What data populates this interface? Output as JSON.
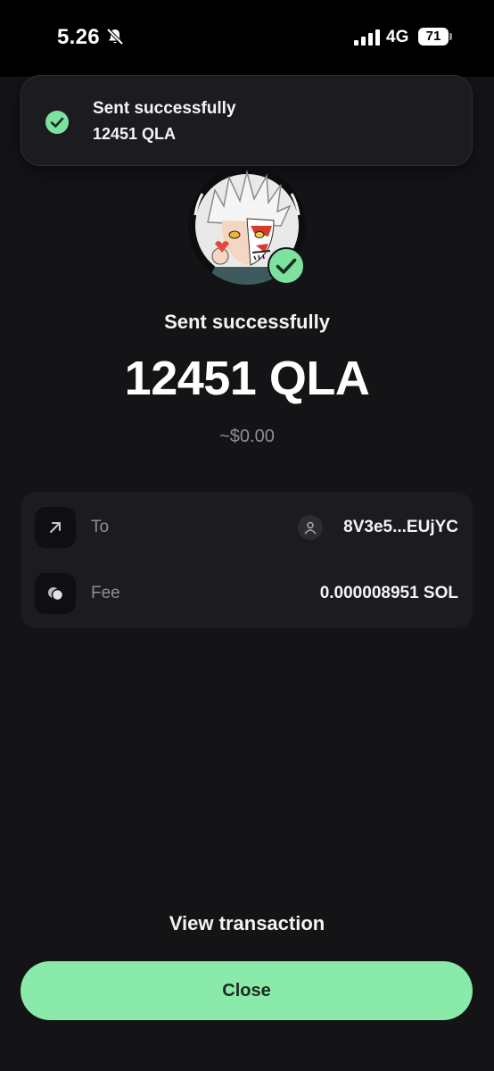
{
  "status_bar": {
    "time": "5.26",
    "network": "4G",
    "battery": "71"
  },
  "toast": {
    "title": "Sent successfully",
    "amount": "12451 QLA"
  },
  "result": {
    "headline": "Sent successfully",
    "amount": "12451 QLA",
    "fiat_value": "~$0.00"
  },
  "details": {
    "to": {
      "label": "To",
      "value": "8V3e5...EUjYC"
    },
    "fee": {
      "label": "Fee",
      "value": "0.000008951 SOL"
    }
  },
  "actions": {
    "view_transaction": "View transaction",
    "close": "Close"
  },
  "colors": {
    "accent_green": "#8aeaa9",
    "check_green": "#7de2a0",
    "background": "#141417",
    "card": "#1c1c20",
    "muted_text": "#8d8d93"
  },
  "icons": {
    "status_bell": "bell-slash-icon",
    "status_signal": "signal-bars-icon",
    "toast": "check-circle-icon",
    "to_row": "arrow-up-right-icon",
    "fee_row": "coins-icon",
    "recipient": "user-icon"
  }
}
